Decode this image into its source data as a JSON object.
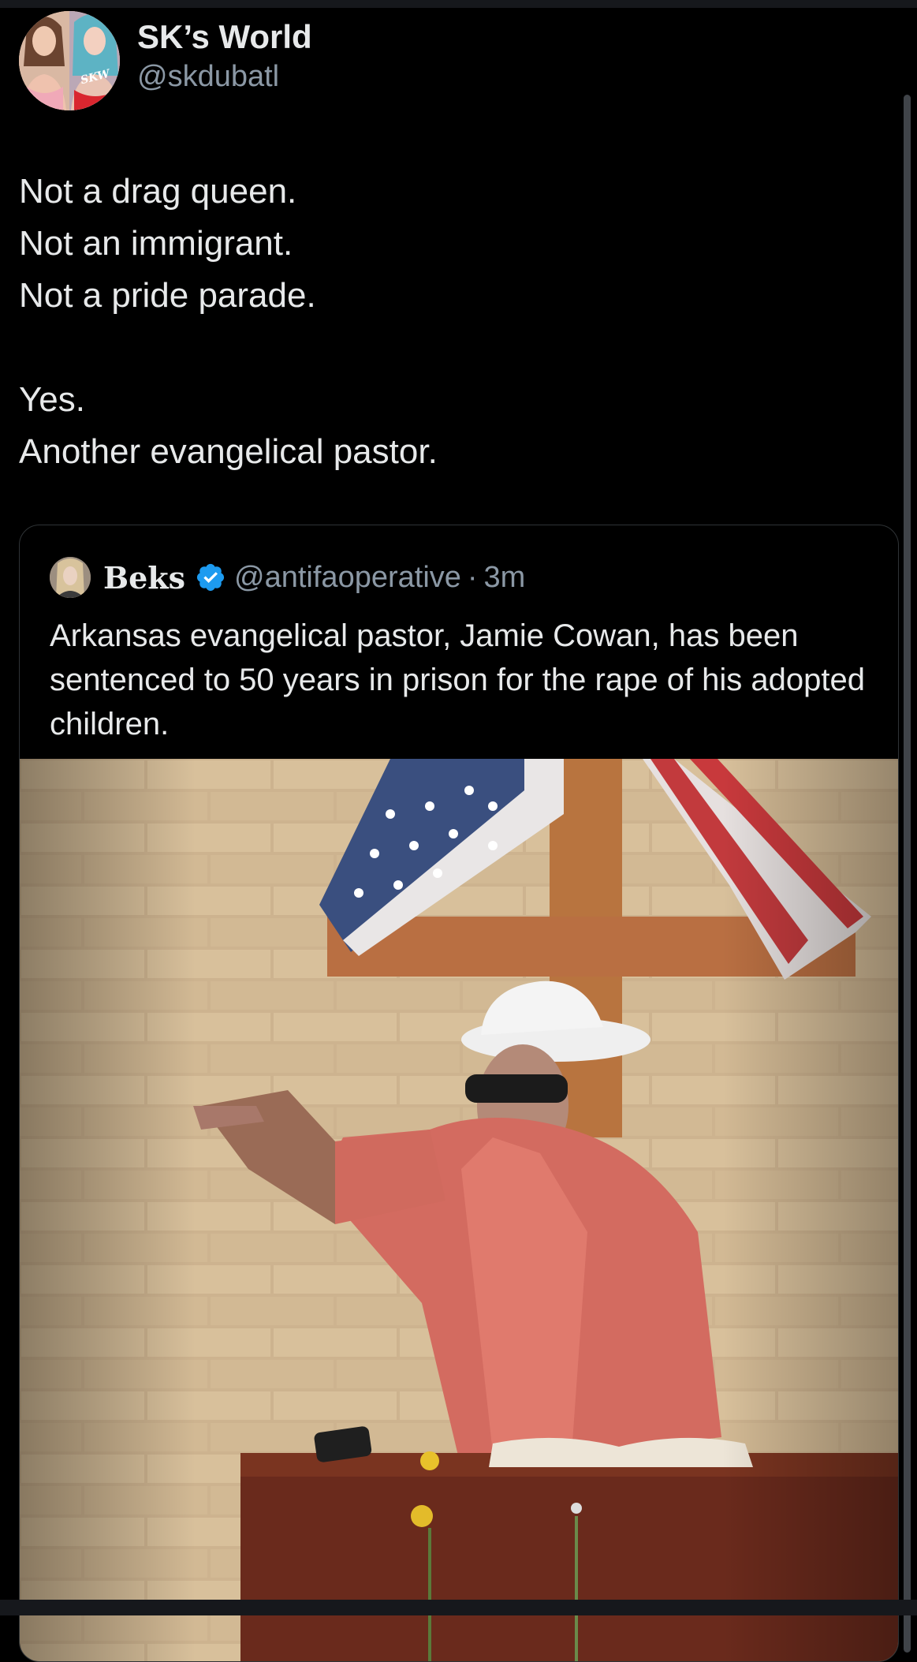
{
  "tweet": {
    "author_name": "SK’s World",
    "author_handle": "@skdubatl",
    "avatar_badge": "SKW",
    "lines": [
      "Not a drag queen.",
      "Not an immigrant.",
      "Not a pride parade.",
      "Yes.",
      "Another evangelical pastor."
    ]
  },
  "quote": {
    "author_name": "Beks",
    "author_handle": "@antifaoperative",
    "separator": "·",
    "time": "3m",
    "text": "Arkansas evangelical pastor, Jamie Cowan, has been sentenced to 50 years in prison for the rape of his adopted children."
  },
  "colors": {
    "background": "#000000",
    "text": "#e7e9ea",
    "secondary": "#8b98a5",
    "verified": "#1d9bf0",
    "border": "#2f3336"
  },
  "icons": [
    "verified-badge-icon"
  ]
}
